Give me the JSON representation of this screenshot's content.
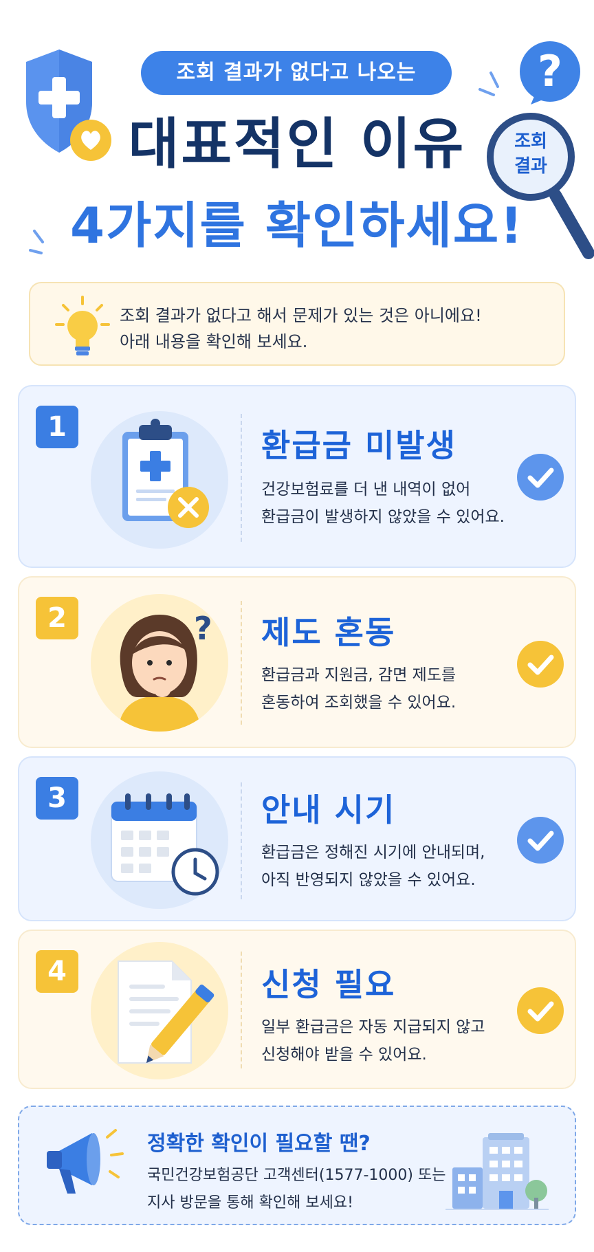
{
  "header": {
    "pill": "조회 결과가 없다고 나오는",
    "title_line1": "대표적인 이유",
    "title_line2": "4가지를 확인하세요!",
    "magnifier_label_1": "조회",
    "magnifier_label_2": "결과",
    "question_mark": "?"
  },
  "tip": {
    "line1": "조회 결과가 없다고 해서 문제가 있는 것은 아니에요!",
    "line2": "아래 내용을 확인해 보세요."
  },
  "cards": [
    {
      "number": "1",
      "title": "환급금 미발생",
      "desc1": "건강보험료를 더 낸 내역이 없어",
      "desc2": "환급금이 발생하지 않았을 수 있어요.",
      "icon": "clipboard-x-icon",
      "theme": "blue"
    },
    {
      "number": "2",
      "title": "제도 혼동",
      "desc1": "환급금과 지원금, 감면 제도를",
      "desc2": "혼동하여 조회했을 수 있어요.",
      "icon": "confused-woman-icon",
      "theme": "yellow"
    },
    {
      "number": "3",
      "title": "안내 시기",
      "desc1": "환급금은 정해진 시기에 안내되며,",
      "desc2": "아직 반영되지 않았을 수 있어요.",
      "icon": "calendar-clock-icon",
      "theme": "blue"
    },
    {
      "number": "4",
      "title": "신청 필요",
      "desc1": "일부 환급금은 자동 지급되지 않고",
      "desc2": "신청해야 받을 수 있어요.",
      "icon": "document-pencil-icon",
      "theme": "yellow"
    }
  ],
  "footer": {
    "title": "정확한 확인이 필요할 땐?",
    "line1": "국민건강보험공단 고객센터(1577-1000) 또는",
    "line2": "지사 방문을 통해 확인해 보세요!"
  },
  "colors": {
    "primary_blue": "#3d82e8",
    "dark_navy": "#143366",
    "accent_yellow": "#f6c338",
    "card_blue_bg": "#eef4ff",
    "card_yellow_bg": "#fff9ee"
  }
}
